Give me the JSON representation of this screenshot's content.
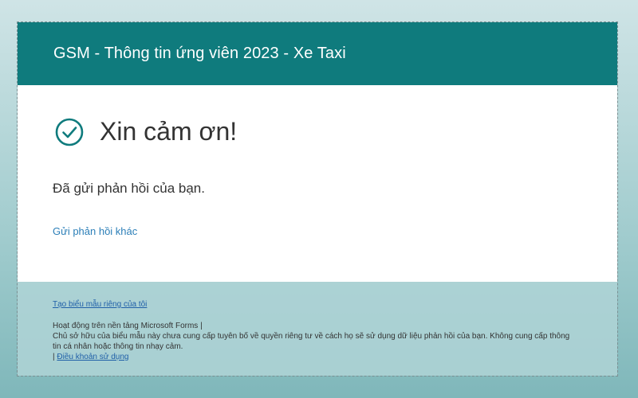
{
  "header": {
    "title": "GSM - Thông tin ứng viên 2023 - Xe Taxi"
  },
  "confirmation": {
    "icon": "check-circle-icon",
    "title": "Xin cảm ơn!",
    "message": "Đã gửi phản hồi của bạn.",
    "another_response_link": "Gửi phản hồi khác"
  },
  "footer": {
    "create_form_link": "Tạo biểu mẫu riêng của tôi",
    "powered_by": "Hoạt động trên nền tảng Microsoft Forms |",
    "privacy_notice": "Chủ sở hữu của biểu mẫu này chưa cung cấp tuyên bố về quyền riêng tư về cách họ sẽ sử dụng dữ liệu phản hồi của bạn. Không cung cấp thông tin cá nhân hoặc thông tin nhạy cảm.",
    "separator": "|",
    "terms_link": "Điều khoản sử dụng"
  },
  "colors": {
    "header_bg": "#0f7b7d",
    "accent": "#0f7b7d",
    "link": "#2c7fb8"
  }
}
